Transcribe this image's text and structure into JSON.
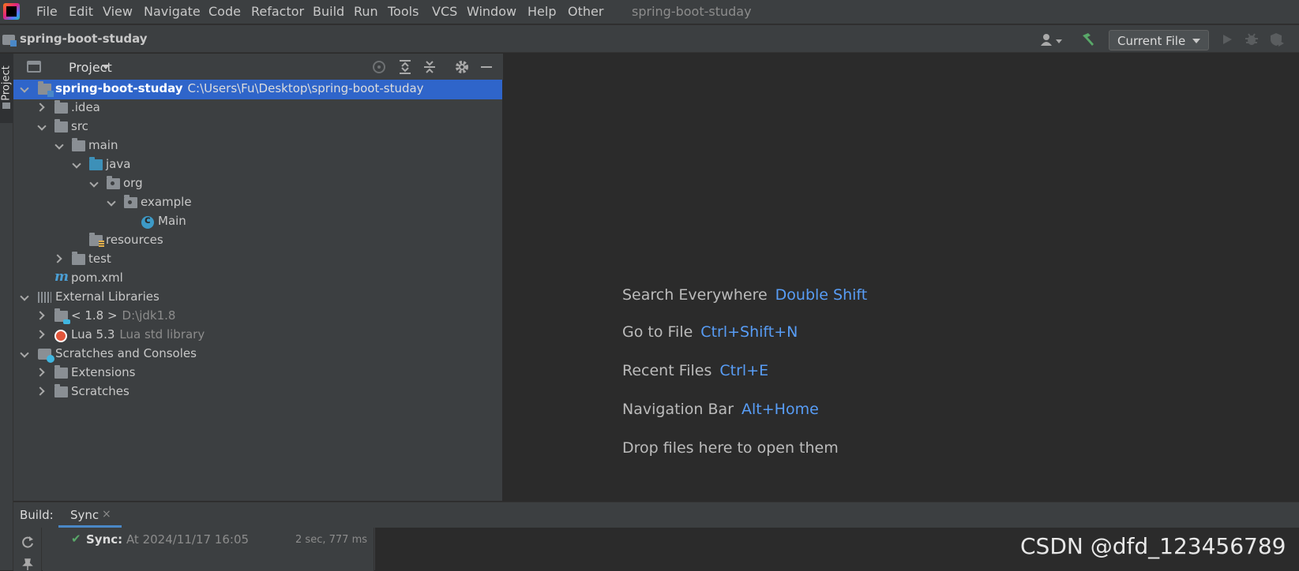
{
  "menubar": {
    "items": [
      "File",
      "Edit",
      "View",
      "Navigate",
      "Code",
      "Refactor",
      "Build",
      "Run",
      "Tools",
      "VCS",
      "Window",
      "Help",
      "Other"
    ],
    "window_title": "spring-boot-studay"
  },
  "navbar": {
    "project_crumb": "spring-boot-studay",
    "run_config": "Current File"
  },
  "left_strip": {
    "project_tab": "Project"
  },
  "project_panel": {
    "title": "Project",
    "tree": [
      {
        "label": "spring-boot-studay",
        "sub": "C:\\Users\\Fu\\Desktop\\spring-boot-studay"
      },
      {
        "label": ".idea",
        "sub": ""
      },
      {
        "label": "src",
        "sub": ""
      },
      {
        "label": "main",
        "sub": ""
      },
      {
        "label": "java",
        "sub": ""
      },
      {
        "label": "org",
        "sub": ""
      },
      {
        "label": "example",
        "sub": ""
      },
      {
        "label": "Main",
        "sub": ""
      },
      {
        "label": "resources",
        "sub": ""
      },
      {
        "label": "test",
        "sub": ""
      },
      {
        "label": "pom.xml",
        "sub": ""
      },
      {
        "label": "External Libraries",
        "sub": ""
      },
      {
        "label": "< 1.8 >",
        "sub": "D:\\jdk1.8"
      },
      {
        "label": "Lua 5.3",
        "sub": "Lua std library"
      },
      {
        "label": "Scratches and Consoles",
        "sub": ""
      },
      {
        "label": "Extensions",
        "sub": ""
      },
      {
        "label": "Scratches",
        "sub": ""
      }
    ]
  },
  "editor": {
    "hints": [
      {
        "text": "Search Everywhere",
        "key": "Double Shift"
      },
      {
        "text": "Go to File",
        "key": "Ctrl+Shift+N"
      },
      {
        "text": "Recent Files",
        "key": "Ctrl+E"
      },
      {
        "text": "Navigation Bar",
        "key": "Alt+Home"
      },
      {
        "text": "Drop files here to open them",
        "key": ""
      }
    ]
  },
  "build": {
    "label": "Build:",
    "tab": "Sync",
    "close": "×",
    "entry_title": "Sync:",
    "entry_time": "At 2024/11/17 16:05",
    "duration": "2 sec, 777 ms"
  },
  "watermark": "CSDN @dfd_123456789",
  "colors": {
    "accent": "#2f65ca",
    "link": "#589df6",
    "success": "#59a869"
  }
}
